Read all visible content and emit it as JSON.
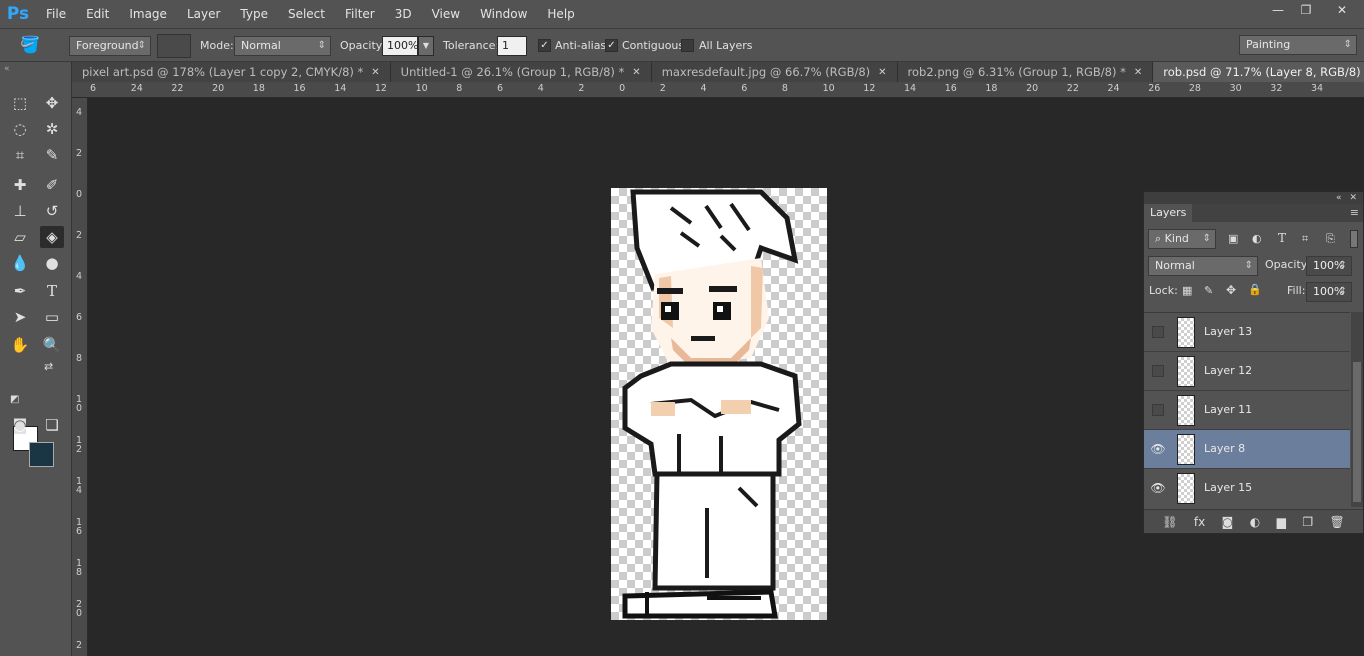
{
  "app": {
    "logo": "Ps"
  },
  "menu": [
    "File",
    "Edit",
    "Image",
    "Layer",
    "Type",
    "Select",
    "Filter",
    "3D",
    "View",
    "Window",
    "Help"
  ],
  "window_controls": {
    "minimize": "—",
    "restore": "❐",
    "close": "✕"
  },
  "options": {
    "preset": "Foreground",
    "mode_label": "Mode:",
    "mode_value": "Normal",
    "opacity_label": "Opacity:",
    "opacity_value": "100%",
    "tolerance_label": "Tolerance:",
    "tolerance_value": "1",
    "anti_alias": "Anti-alias",
    "contiguous": "Contiguous",
    "all_layers": "All Layers",
    "workspace": "Painting"
  },
  "tabs": [
    {
      "label": "pixel art.psd @ 178% (Layer 1 copy 2, CMYK/8) *",
      "active": false
    },
    {
      "label": "Untitled-1 @ 26.1% (Group 1, RGB/8) *",
      "active": false
    },
    {
      "label": "maxresdefault.jpg @ 66.7% (RGB/8)",
      "active": false
    },
    {
      "label": "rob2.png @ 6.31% (Group 1, RGB/8) *",
      "active": false
    },
    {
      "label": "rob.psd @ 71.7% (Layer 8, RGB/8) *",
      "active": true
    }
  ],
  "ruler_top": [
    "6",
    "24",
    "22",
    "20",
    "18",
    "16",
    "14",
    "12",
    "10",
    "8",
    "6",
    "4",
    "2",
    "0",
    "2",
    "4",
    "6",
    "8",
    "10",
    "12",
    "14",
    "16",
    "18",
    "20",
    "22",
    "24",
    "26",
    "28",
    "30",
    "32",
    "34"
  ],
  "ruler_left": [
    "4",
    "2",
    "0",
    "2",
    "4",
    "6",
    "8",
    "1 0",
    "1 2",
    "1 4",
    "1 6",
    "1 8",
    "2 0",
    "2"
  ],
  "colors": {
    "foreground": "#ffffff",
    "background": "#1a3644",
    "selected_layer": "#6b7e9c"
  },
  "layers_panel": {
    "title": "Layers",
    "filter_kind": "Kind",
    "blend_mode": "Normal",
    "opacity_label": "Opacity:",
    "opacity_value": "100%",
    "lock_label": "Lock:",
    "fill_label": "Fill:",
    "fill_value": "100%",
    "layers": [
      {
        "name": "Layer 13",
        "visible": false,
        "selected": false
      },
      {
        "name": "Layer 12",
        "visible": false,
        "selected": false
      },
      {
        "name": "Layer 11",
        "visible": false,
        "selected": false
      },
      {
        "name": "Layer 8",
        "visible": true,
        "selected": true
      },
      {
        "name": "Layer 15",
        "visible": true,
        "selected": false
      }
    ],
    "bottom_icons": [
      "link-icon",
      "fx-icon",
      "mask-icon",
      "adjustment-icon",
      "folder-icon",
      "new-layer-icon",
      "trash-icon"
    ]
  }
}
